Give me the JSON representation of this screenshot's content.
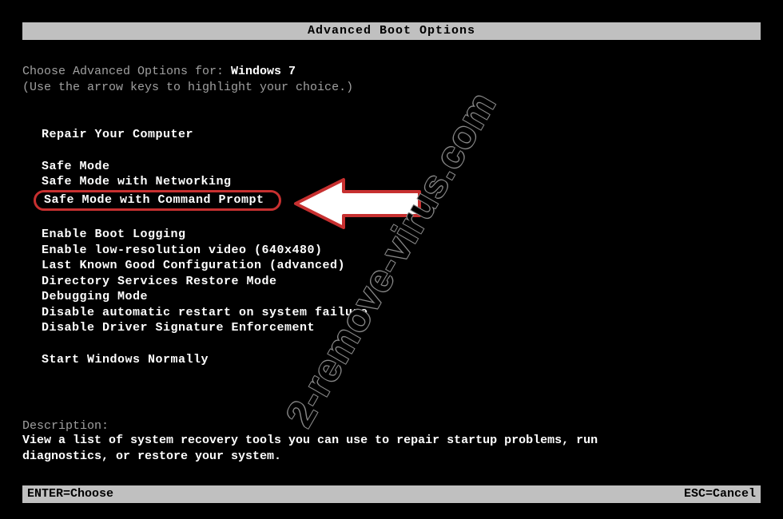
{
  "title": "Advanced Boot Options",
  "intro": {
    "prefix": "Choose Advanced Options for: ",
    "os": "Windows 7",
    "hint": "(Use the arrow keys to highlight your choice.)"
  },
  "menu": {
    "group1": [
      "Repair Your Computer"
    ],
    "group2": [
      "Safe Mode",
      "Safe Mode with Networking",
      "Safe Mode with Command Prompt"
    ],
    "group3": [
      "Enable Boot Logging",
      "Enable low-resolution video (640x480)",
      "Last Known Good Configuration (advanced)",
      "Directory Services Restore Mode",
      "Debugging Mode",
      "Disable automatic restart on system failure",
      "Disable Driver Signature Enforcement"
    ],
    "group4": [
      "Start Windows Normally"
    ],
    "highlighted_index": "group2.2"
  },
  "description": {
    "label": "Description:",
    "text": "View a list of system recovery tools you can use to repair startup problems, run diagnostics, or restore your system."
  },
  "footer": {
    "enter": "ENTER=Choose",
    "esc": "ESC=Cancel"
  },
  "watermark": "2-remove-virus.com"
}
